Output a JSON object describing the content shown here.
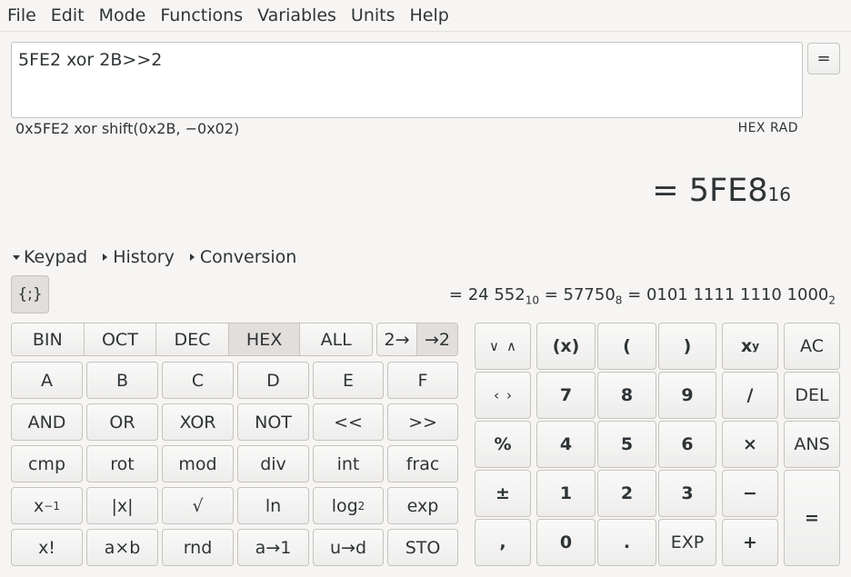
{
  "menu": [
    "File",
    "Edit",
    "Mode",
    "Functions",
    "Variables",
    "Units",
    "Help"
  ],
  "expression": "5FE2 xor 2B>>2",
  "equals_button": "=",
  "parsed": "0x5FE2 xor shift(0x2B, −0x02)",
  "mode_indicators": "HEX RAD",
  "result": {
    "prefix": "= ",
    "value": "5FE8",
    "base": "16"
  },
  "expanders": {
    "keypad": "Keypad",
    "history": "History",
    "conversion": "Conversion"
  },
  "brace_button": "{;}",
  "conversions": [
    {
      "prefix": "= ",
      "value": "24 552",
      "base": "10"
    },
    {
      "prefix": " = ",
      "value": "57750",
      "base": "8"
    },
    {
      "prefix": " = ",
      "value": "0101 1111 1110 1000",
      "base": "2"
    }
  ],
  "base_modes": {
    "bin": "BIN",
    "oct": "OCT",
    "dec": "DEC",
    "hex": "HEX",
    "all": "ALL",
    "active": "HEX"
  },
  "convert_to": "2→",
  "convert_from": "→2",
  "hex_digits": [
    "A",
    "B",
    "C",
    "D",
    "E",
    "F"
  ],
  "logic": [
    "AND",
    "OR",
    "XOR",
    "NOT",
    "<<",
    ">>"
  ],
  "int_ops": [
    "cmp",
    "rot",
    "mod",
    "div",
    "int",
    "frac"
  ],
  "funcs": {
    "inverse": "x",
    "inverse_exp": "−1",
    "abs": "|x|",
    "sqrt": "√",
    "ln": "ln",
    "log": "log",
    "log_base": "2",
    "exp": "exp"
  },
  "misc": [
    "x!",
    "a×b",
    "rnd",
    "a→1",
    "u→d",
    "STO"
  ],
  "keypad": {
    "paren_x": "(x)",
    "lparen": "(",
    "rparen": ")",
    "power": "x",
    "power_exp": "y",
    "ac": "AC",
    "seven": "7",
    "eight": "8",
    "nine": "9",
    "divide": "/",
    "del": "DEL",
    "percent": "%",
    "four": "4",
    "five": "5",
    "six": "6",
    "multiply": "×",
    "ans": "ANS",
    "plusminus": "±",
    "one": "1",
    "two": "2",
    "three": "3",
    "minus": "−",
    "comma": ",",
    "zero": "0",
    "dot": ".",
    "exp": "EXP",
    "plus": "+",
    "equals": "="
  },
  "icons": {
    "up_down": "chevron-up-down-icon",
    "left_right": "chevron-left-right-icon"
  }
}
